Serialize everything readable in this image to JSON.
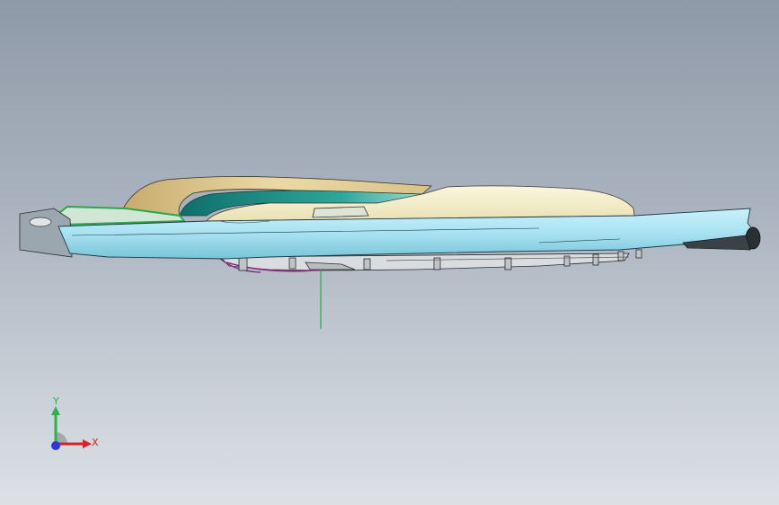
{
  "viewport": {
    "background_top": "#8f9aa8",
    "background_bottom": "#dde1e6"
  },
  "model": {
    "body_color": "#a8e2f2",
    "top_color": "#f1ecc6",
    "tan_color": "#d9c48e",
    "teal_color": "#1f8f86",
    "green_color": "#2aa84a",
    "magenta_color": "#8a2b86"
  },
  "triad": {
    "y_label": "Y",
    "x_label": "X",
    "y_color": "#2bb24c",
    "x_color": "#d62424",
    "z_color": "#2a3ad8"
  }
}
